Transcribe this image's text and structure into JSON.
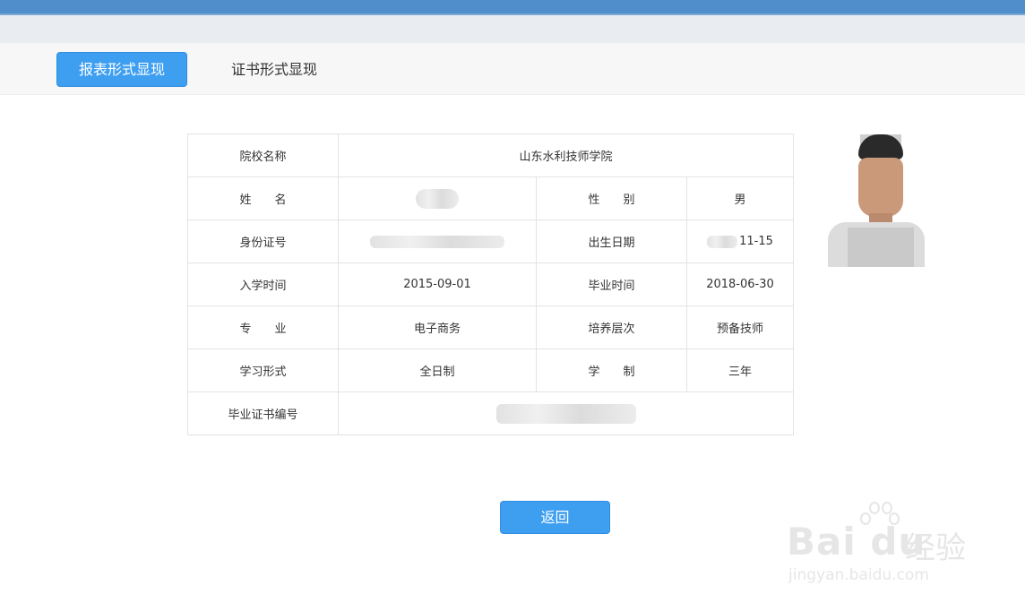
{
  "tabs": {
    "report_view": "报表形式显现",
    "certificate_view": "证书形式显现"
  },
  "record": {
    "school_label": "院校名称",
    "school_value": "山东水利技师学院",
    "name_label": "姓　　名",
    "gender_label": "性　　别",
    "gender_value": "男",
    "id_label": "身份证号",
    "birth_label": "出生日期",
    "birth_visible_suffix": "11-15",
    "enroll_label": "入学时间",
    "enroll_value": "2015-09-01",
    "graduate_label": "毕业时间",
    "graduate_value": "2018-06-30",
    "major_label": "专　　业",
    "major_value": "电子商务",
    "level_label": "培养层次",
    "level_value": "预备技师",
    "study_form_label": "学习形式",
    "study_form_value": "全日制",
    "duration_label": "学　　制",
    "duration_value": "三年",
    "cert_no_label": "毕业证书编号"
  },
  "actions": {
    "back_label": "返回"
  },
  "watermark": {
    "logo_text": "Bai du",
    "cn_text": "经验",
    "url": "jingyan.baidu.com"
  },
  "colors": {
    "header_blue": "#4f8ecb",
    "button_blue": "#3e9ff1",
    "table_border": "#e3e3e3"
  }
}
